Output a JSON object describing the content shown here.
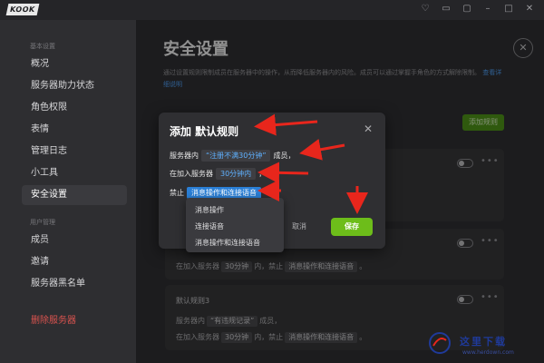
{
  "app": {
    "logo": "KOOK",
    "window_icons": [
      "shirt-icon",
      "mailbox-icon",
      "window-icon",
      "minimize-icon",
      "maximize-icon",
      "close-icon"
    ]
  },
  "sidebar": {
    "section_basic": "基本设置",
    "section_users": "用户管理",
    "items": [
      {
        "label": "概况"
      },
      {
        "label": "服务器助力状态"
      },
      {
        "label": "角色权限"
      },
      {
        "label": "表情"
      },
      {
        "label": "管理日志"
      },
      {
        "label": "小工具"
      },
      {
        "label": "安全设置"
      },
      {
        "label": "成员"
      },
      {
        "label": "邀请"
      },
      {
        "label": "服务器黑名单"
      }
    ],
    "delete_label": "删除服务器",
    "active_index": 6
  },
  "main": {
    "title": "安全设置",
    "desc": "通过设置规则限制成员在服务器中的操作，从而降低服务器内的风险。成员可以通过掌握手角色的方式解除限制。",
    "link": "查看详细说明",
    "add_rule_label": "添加规则",
    "cards": [
      {
        "title": "",
        "line1_prefix": "",
        "line1_chip": "",
        "line1_suffix": "",
        "line2_prefix": "",
        "line2_chip": "",
        "line2_mid": "",
        "line2_chip2": "",
        "line2_suffix": ""
      },
      {
        "title": "",
        "line1_prefix": "",
        "line1_chip": "",
        "line1_suffix": "",
        "line2_prefix": "在加入服务器",
        "line2_chip": "30分钟",
        "line2_mid": "内，禁止",
        "line2_chip2": "消息操作和连接语音",
        "line2_suffix": "。"
      },
      {
        "title": "默认规则3",
        "line1_prefix": "服务器内",
        "line1_chip": "“有违规记录”",
        "line1_suffix": "成员，",
        "line2_prefix": "在加入服务器",
        "line2_chip": "30分钟",
        "line2_mid": "内，禁止",
        "line2_chip2": "消息操作和连接语音",
        "line2_suffix": "。"
      }
    ]
  },
  "modal": {
    "title": "添加 默认规则",
    "row1_prefix": "服务器内",
    "row1_value": "“注册不满30分钟”",
    "row1_suffix": "成员，",
    "row2_prefix": "在加入服务器",
    "row2_value": "30分钟内",
    "row2_suffix": "，",
    "row3_prefix": "禁止",
    "row3_value": "消息操作和连接语音",
    "cancel_label": "取消",
    "save_label": "保存",
    "dropdown_options": [
      "消息操作",
      "连接语音",
      "消息操作和连接语音"
    ]
  },
  "watermark": {
    "cn": "这里下载",
    "url": "www.herdown.com"
  },
  "colors": {
    "accent_green": "#6dbd1a",
    "link_blue": "#4da3ff",
    "arrow_red": "#e8261c",
    "danger": "#d9534f"
  }
}
